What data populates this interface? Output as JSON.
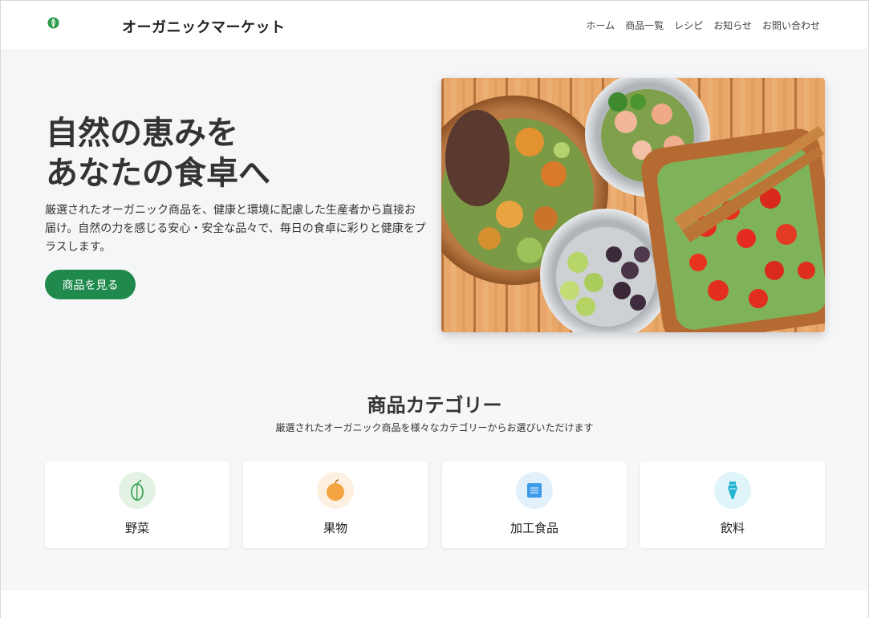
{
  "header": {
    "site_title": "オーガニックマーケット",
    "nav": [
      "ホーム",
      "商品一覧",
      "レシピ",
      "お知らせ",
      "お問い合わせ"
    ]
  },
  "hero": {
    "title_line1": "自然の恵みを",
    "title_line2": "あなたの食卓へ",
    "description": "厳選されたオーガニック商品を、健康と環境に配慮した生産者から直接お届け。自然の力を感じる安心・安全な品々で、毎日の食卓に彩りと健康をプラスします。",
    "cta_label": "商品を見る"
  },
  "categories": {
    "title": "商品カテゴリー",
    "subtitle": "厳選されたオーガニック商品を様々なカテゴリーからお選びいただけます",
    "items": [
      {
        "label": "野菜",
        "icon": "vegetable-icon",
        "color": "#2e9a4a"
      },
      {
        "label": "果物",
        "icon": "orange-icon",
        "color": "#f5a442"
      },
      {
        "label": "加工食品",
        "icon": "package-icon",
        "color": "#3d9be9"
      },
      {
        "label": "飲料",
        "icon": "drink-icon",
        "color": "#22b3cf"
      }
    ]
  },
  "colors": {
    "accent": "#1f8a4c",
    "hero_bg": "#f5f6f8"
  }
}
